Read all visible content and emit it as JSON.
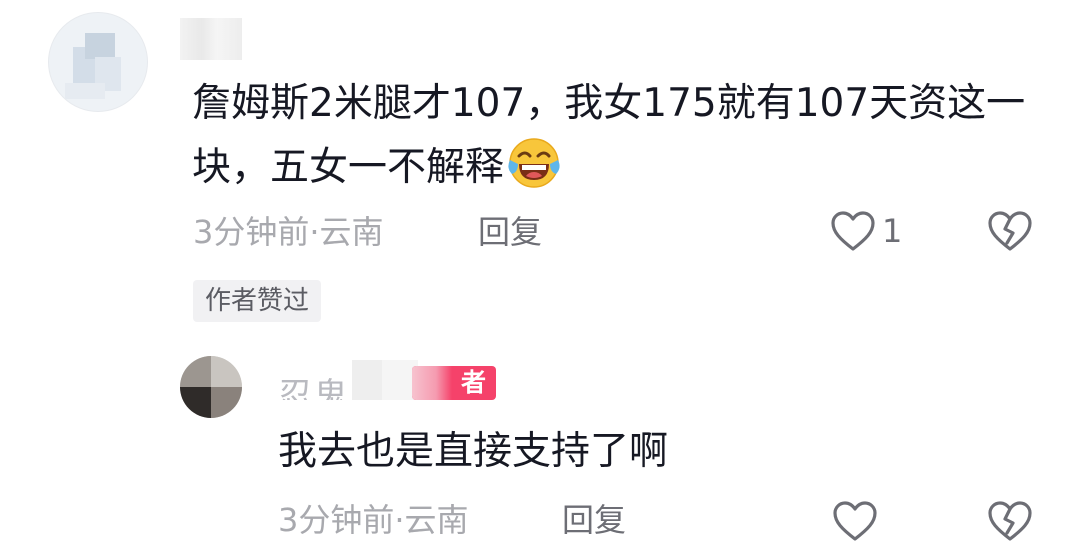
{
  "comment": {
    "text": "詹姆斯2米腿才107，我女175就有107天资这一块，五女一不解释",
    "emoji": "laughing-with-tears-emoji",
    "time": "3分钟前",
    "location": "云南",
    "meta_text": "3分钟前·云南",
    "reply_label": "回复",
    "like_count": "1",
    "author_liked_label": "作者赞过"
  },
  "reply": {
    "name_partial": "忍鬼",
    "author_tag": "者",
    "text": "我去也是直接支持了啊",
    "meta_text": "3分钟前·云南",
    "reply_label": "回复"
  },
  "colors": {
    "text_primary": "#161823",
    "text_secondary": "#a8a9ae",
    "action_text": "#6d6e75",
    "author_tag_bg": "#f5426a",
    "badge_bg": "#f1f1f3"
  }
}
